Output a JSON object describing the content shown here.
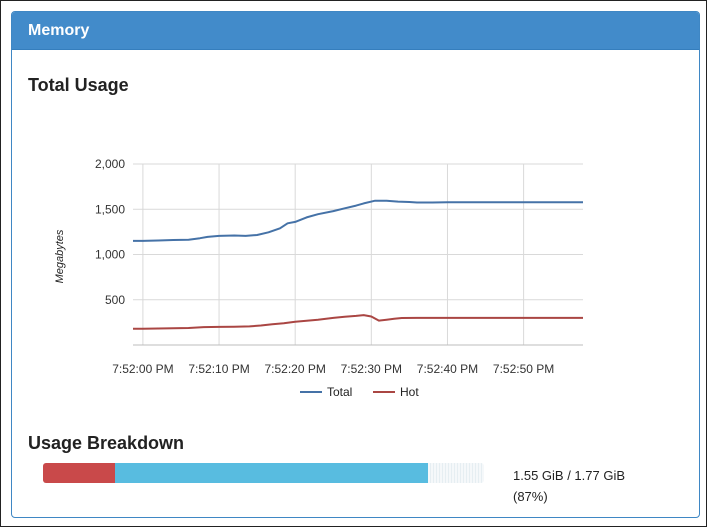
{
  "panel": {
    "title": "Memory"
  },
  "total_usage": {
    "title": "Total Usage"
  },
  "chart_data": {
    "type": "line",
    "ylabel": "Megabytes",
    "ylim": [
      0,
      2000
    ],
    "yticks": [
      500,
      1000,
      1500,
      2000
    ],
    "ytick_labels": [
      "500",
      "1,000",
      "1,500",
      "2,000"
    ],
    "xlim": [
      -1.3,
      57.8
    ],
    "xticks": [
      0,
      10,
      20,
      30,
      40,
      50
    ],
    "xtick_labels": [
      "7:52:00 PM",
      "7:52:10 PM",
      "7:52:20 PM",
      "7:52:30 PM",
      "7:52:40 PM",
      "7:52:50 PM"
    ],
    "grid": true,
    "legend_position": "bottom",
    "series": [
      {
        "name": "Total",
        "color": "#4572a7",
        "x": [
          -1.3,
          0,
          2,
          4,
          6,
          7.5,
          8.5,
          10,
          12,
          13.5,
          15,
          16.5,
          18,
          19,
          20,
          21.5,
          23,
          25,
          26.5,
          28,
          29,
          30.5,
          32,
          33.5,
          35,
          36,
          38,
          40,
          42,
          44,
          46,
          48,
          50,
          52,
          54,
          56,
          57.8
        ],
        "y": [
          1150,
          1150,
          1155,
          1160,
          1162,
          1180,
          1195,
          1205,
          1210,
          1205,
          1215,
          1245,
          1290,
          1345,
          1360,
          1410,
          1445,
          1480,
          1510,
          1540,
          1565,
          1595,
          1595,
          1585,
          1580,
          1575,
          1575,
          1578,
          1578,
          1578,
          1578,
          1578,
          1578,
          1578,
          1578,
          1578,
          1578
        ]
      },
      {
        "name": "Hot",
        "color": "#aa4643",
        "x": [
          -1.3,
          0,
          2,
          4,
          6,
          8,
          10,
          12,
          14,
          15.5,
          17,
          18.5,
          20,
          21.5,
          23,
          25,
          26.5,
          28,
          29,
          30,
          31,
          32,
          33,
          34,
          36,
          38,
          40,
          42,
          44,
          46,
          48,
          50,
          52,
          54,
          56,
          57.8
        ],
        "y": [
          180,
          180,
          182,
          185,
          188,
          198,
          200,
          202,
          205,
          215,
          230,
          240,
          258,
          268,
          280,
          300,
          312,
          322,
          330,
          315,
          270,
          280,
          290,
          298,
          300,
          300,
          300,
          300,
          300,
          300,
          300,
          300,
          300,
          300,
          300,
          300
        ]
      }
    ]
  },
  "usage_breakdown": {
    "title": "Usage Breakdown",
    "hot_fraction": 0.163,
    "total_fraction": 0.874,
    "hot_color": "#c9494a",
    "total_color": "#58bce0",
    "amount": "1.55 GiB / 1.77 GiB",
    "percent": "(87%)"
  }
}
